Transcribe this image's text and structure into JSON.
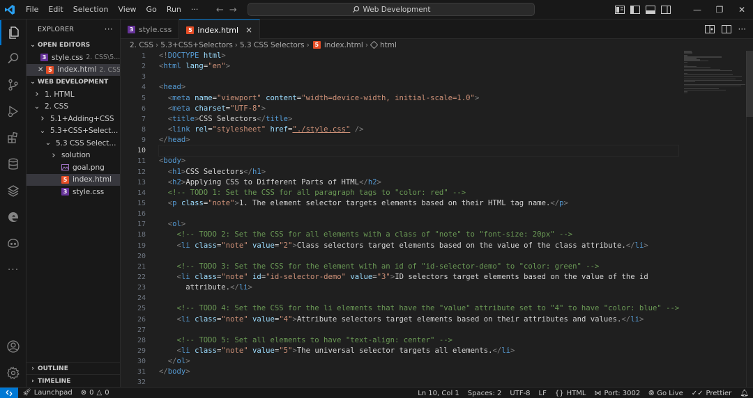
{
  "titlebar": {
    "menu": [
      "File",
      "Edit",
      "Selection",
      "View",
      "Go",
      "Run",
      "···"
    ],
    "search_text": "Web Development"
  },
  "activity_icons": [
    "explorer-icon",
    "search-icon",
    "source-control-icon",
    "run-debug-icon",
    "extensions-icon",
    "database-icon",
    "layers-icon",
    "edge-icon",
    "github-copilot-icon",
    "more-icon",
    "account-icon",
    "settings-gear-icon"
  ],
  "sidebar": {
    "title": "EXPLORER",
    "more": "···",
    "open_editors_title": "OPEN EDITORS",
    "open_editors": [
      {
        "name": "style.css",
        "desc": "2. CSS\\5...",
        "type": "css",
        "selected": false
      },
      {
        "name": "index.html",
        "desc": "2. CSS\\5...",
        "type": "html",
        "selected": true
      }
    ],
    "workspace_title": "WEB DEVELOPMENT",
    "tree": [
      {
        "name": "1. HTML",
        "kind": "folder",
        "open": false,
        "depth": 1
      },
      {
        "name": "2. CSS",
        "kind": "folder",
        "open": true,
        "depth": 1
      },
      {
        "name": "5.1+Adding+CSS",
        "kind": "folder",
        "open": false,
        "depth": 2
      },
      {
        "name": "5.3+CSS+Select...",
        "kind": "folder",
        "open": true,
        "depth": 2
      },
      {
        "name": "5.3 CSS Select...",
        "kind": "folder",
        "open": true,
        "depth": 3
      },
      {
        "name": "solution",
        "kind": "folder",
        "open": false,
        "depth": 4
      },
      {
        "name": "goal.png",
        "kind": "png",
        "depth": 4
      },
      {
        "name": "index.html",
        "kind": "html",
        "depth": 4,
        "selected": true
      },
      {
        "name": "style.css",
        "kind": "css",
        "depth": 4
      }
    ],
    "outline_title": "OUTLINE",
    "timeline_title": "TIMELINE"
  },
  "tabs": [
    {
      "label": "style.css",
      "type": "css",
      "active": false
    },
    {
      "label": "index.html",
      "type": "html",
      "active": true,
      "close": "×"
    }
  ],
  "breadcrumb": [
    "2. CSS",
    "5.3+CSS+Selectors",
    "5.3 CSS Selectors",
    "index.html",
    "html"
  ],
  "editor": {
    "current_line": 10,
    "lines": [
      [
        [
          "b",
          "<!"
        ],
        [
          "d",
          "DOCTYPE"
        ],
        [
          "x",
          " "
        ],
        [
          "a",
          "html"
        ],
        [
          "b",
          ">"
        ]
      ],
      [
        [
          "b",
          "<"
        ],
        [
          "t",
          "html"
        ],
        [
          "x",
          " "
        ],
        [
          "a",
          "lang"
        ],
        [
          "x",
          "="
        ],
        [
          "s",
          "\"en\""
        ],
        [
          "b",
          ">"
        ]
      ],
      [],
      [
        [
          "b",
          "<"
        ],
        [
          "t",
          "head"
        ],
        [
          "b",
          ">"
        ]
      ],
      [
        [
          "x",
          "  "
        ],
        [
          "b",
          "<"
        ],
        [
          "t",
          "meta"
        ],
        [
          "x",
          " "
        ],
        [
          "a",
          "name"
        ],
        [
          "x",
          "="
        ],
        [
          "s",
          "\"viewport\""
        ],
        [
          "x",
          " "
        ],
        [
          "a",
          "content"
        ],
        [
          "x",
          "="
        ],
        [
          "s",
          "\"width=device-width, initial-scale=1.0\""
        ],
        [
          "b",
          ">"
        ]
      ],
      [
        [
          "x",
          "  "
        ],
        [
          "b",
          "<"
        ],
        [
          "t",
          "meta"
        ],
        [
          "x",
          " "
        ],
        [
          "a",
          "charset"
        ],
        [
          "x",
          "="
        ],
        [
          "s",
          "\"UTF-8\""
        ],
        [
          "b",
          ">"
        ]
      ],
      [
        [
          "x",
          "  "
        ],
        [
          "b",
          "<"
        ],
        [
          "t",
          "title"
        ],
        [
          "b",
          ">"
        ],
        [
          "x",
          "CSS Selectors"
        ],
        [
          "b",
          "</"
        ],
        [
          "t",
          "title"
        ],
        [
          "b",
          ">"
        ]
      ],
      [
        [
          "x",
          "  "
        ],
        [
          "b",
          "<"
        ],
        [
          "t",
          "link"
        ],
        [
          "x",
          " "
        ],
        [
          "a",
          "rel"
        ],
        [
          "x",
          "="
        ],
        [
          "s",
          "\"stylesheet\""
        ],
        [
          "x",
          " "
        ],
        [
          "a",
          "href"
        ],
        [
          "x",
          "="
        ],
        [
          "s",
          "\"./style.css\""
        ],
        [
          "x",
          " "
        ],
        [
          "b",
          "/>"
        ]
      ],
      [
        [
          "b",
          "</"
        ],
        [
          "t",
          "head"
        ],
        [
          "b",
          ">"
        ]
      ],
      [],
      [
        [
          "b",
          "<"
        ],
        [
          "t",
          "body"
        ],
        [
          "b",
          ">"
        ]
      ],
      [
        [
          "x",
          "  "
        ],
        [
          "b",
          "<"
        ],
        [
          "t",
          "h1"
        ],
        [
          "b",
          ">"
        ],
        [
          "x",
          "CSS Selectors"
        ],
        [
          "b",
          "</"
        ],
        [
          "t",
          "h1"
        ],
        [
          "b",
          ">"
        ]
      ],
      [
        [
          "x",
          "  "
        ],
        [
          "b",
          "<"
        ],
        [
          "t",
          "h2"
        ],
        [
          "b",
          ">"
        ],
        [
          "x",
          "Applying CSS to Different Parts of HTML"
        ],
        [
          "b",
          "</"
        ],
        [
          "t",
          "h2"
        ],
        [
          "b",
          ">"
        ]
      ],
      [
        [
          "x",
          "  "
        ],
        [
          "c",
          "<!-- TODO 1: Set the CSS for all paragraph tags to \"color: red\" -->"
        ]
      ],
      [
        [
          "x",
          "  "
        ],
        [
          "b",
          "<"
        ],
        [
          "t",
          "p"
        ],
        [
          "x",
          " "
        ],
        [
          "a",
          "class"
        ],
        [
          "x",
          "="
        ],
        [
          "s",
          "\"note\""
        ],
        [
          "b",
          ">"
        ],
        [
          "x",
          "1. The element selector targets elements based on their HTML tag name."
        ],
        [
          "b",
          "</"
        ],
        [
          "t",
          "p"
        ],
        [
          "b",
          ">"
        ]
      ],
      [],
      [
        [
          "x",
          "  "
        ],
        [
          "b",
          "<"
        ],
        [
          "t",
          "ol"
        ],
        [
          "b",
          ">"
        ]
      ],
      [
        [
          "x",
          "    "
        ],
        [
          "c",
          "<!-- TODO 2: Set the CSS for all elements with a class of \"note\" to \"font-size: 20px\" -->"
        ]
      ],
      [
        [
          "x",
          "    "
        ],
        [
          "b",
          "<"
        ],
        [
          "t",
          "li"
        ],
        [
          "x",
          " "
        ],
        [
          "a",
          "class"
        ],
        [
          "x",
          "="
        ],
        [
          "s",
          "\"note\""
        ],
        [
          "x",
          " "
        ],
        [
          "a",
          "value"
        ],
        [
          "x",
          "="
        ],
        [
          "s",
          "\"2\""
        ],
        [
          "b",
          ">"
        ],
        [
          "x",
          "Class selectors target elements based on the value of the class attribute."
        ],
        [
          "b",
          "</"
        ],
        [
          "t",
          "li"
        ],
        [
          "b",
          ">"
        ]
      ],
      [],
      [
        [
          "x",
          "    "
        ],
        [
          "c",
          "<!-- TODO 3: Set the CSS for the element with an id of \"id-selector-demo\" to \"color: green\" -->"
        ]
      ],
      [
        [
          "x",
          "    "
        ],
        [
          "b",
          "<"
        ],
        [
          "t",
          "li"
        ],
        [
          "x",
          " "
        ],
        [
          "a",
          "class"
        ],
        [
          "x",
          "="
        ],
        [
          "s",
          "\"note\""
        ],
        [
          "x",
          " "
        ],
        [
          "a",
          "id"
        ],
        [
          "x",
          "="
        ],
        [
          "s",
          "\"id-selector-demo\""
        ],
        [
          "x",
          " "
        ],
        [
          "a",
          "value"
        ],
        [
          "x",
          "="
        ],
        [
          "s",
          "\"3\""
        ],
        [
          "b",
          ">"
        ],
        [
          "x",
          "ID selectors target elements based on the value of the id"
        ]
      ],
      [
        [
          "x",
          "      attribute."
        ],
        [
          "b",
          "</"
        ],
        [
          "t",
          "li"
        ],
        [
          "b",
          ">"
        ]
      ],
      [],
      [
        [
          "x",
          "    "
        ],
        [
          "c",
          "<!-- TODO 4: Set the CSS for the li elements that have the \"value\" attribute set to \"4\" to have \"color: blue\" -->"
        ]
      ],
      [
        [
          "x",
          "    "
        ],
        [
          "b",
          "<"
        ],
        [
          "t",
          "li"
        ],
        [
          "x",
          " "
        ],
        [
          "a",
          "class"
        ],
        [
          "x",
          "="
        ],
        [
          "s",
          "\"note\""
        ],
        [
          "x",
          " "
        ],
        [
          "a",
          "value"
        ],
        [
          "x",
          "="
        ],
        [
          "s",
          "\"4\""
        ],
        [
          "b",
          ">"
        ],
        [
          "x",
          "Attribute selectors target elements based on their attributes and values."
        ],
        [
          "b",
          "</"
        ],
        [
          "t",
          "li"
        ],
        [
          "b",
          ">"
        ]
      ],
      [],
      [
        [
          "x",
          "    "
        ],
        [
          "c",
          "<!-- TODO 5: Set all elements to have \"text-align: center\" -->"
        ]
      ],
      [
        [
          "x",
          "    "
        ],
        [
          "b",
          "<"
        ],
        [
          "t",
          "li"
        ],
        [
          "x",
          " "
        ],
        [
          "a",
          "class"
        ],
        [
          "x",
          "="
        ],
        [
          "s",
          "\"note\""
        ],
        [
          "x",
          " "
        ],
        [
          "a",
          "value"
        ],
        [
          "x",
          "="
        ],
        [
          "s",
          "\"5\""
        ],
        [
          "b",
          ">"
        ],
        [
          "x",
          "The universal selector targets all elements."
        ],
        [
          "b",
          "</"
        ],
        [
          "t",
          "li"
        ],
        [
          "b",
          ">"
        ]
      ],
      [
        [
          "x",
          "  "
        ],
        [
          "b",
          "</"
        ],
        [
          "t",
          "ol"
        ],
        [
          "b",
          ">"
        ]
      ],
      [
        [
          "b",
          "</"
        ],
        [
          "t",
          "body"
        ],
        [
          "b",
          ">"
        ]
      ],
      []
    ]
  },
  "statusbar": {
    "remote": "✕",
    "launchpad": "Launchpad",
    "problems": "0",
    "warnings": "0",
    "position": "Ln 10, Col 1",
    "spaces": "Spaces: 2",
    "encoding": "UTF-8",
    "eol": "LF",
    "language": "HTML",
    "port": "Port: 3002",
    "golive": "Go Live",
    "prettier": "Prettier"
  },
  "colors": {
    "accent": "#0078d4",
    "css_icon": "#663399",
    "html_icon": "#e44d26"
  }
}
